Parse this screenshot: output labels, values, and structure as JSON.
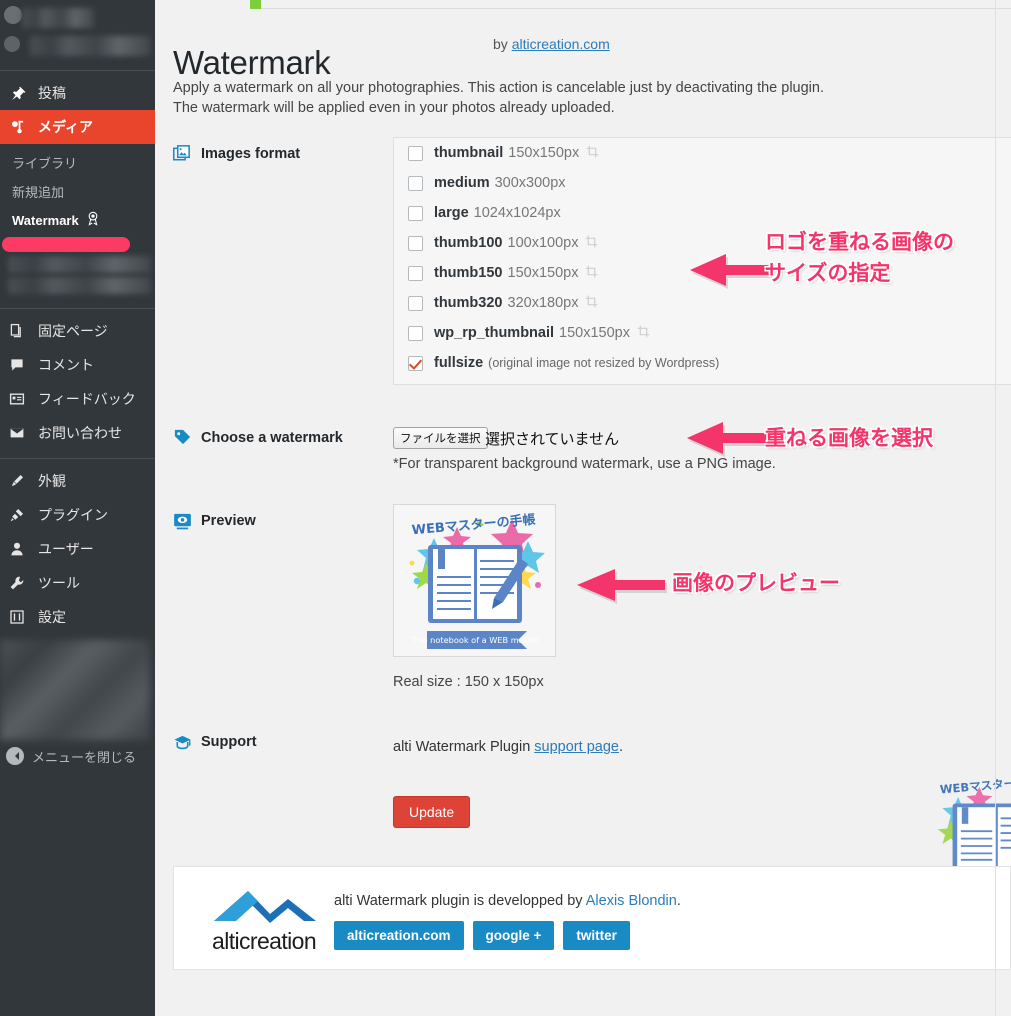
{
  "sidebar": {
    "items": [
      {
        "label": "投稿",
        "icon": "pin-icon",
        "state": "normal"
      },
      {
        "label": "メディア",
        "icon": "media-icon",
        "state": "current"
      }
    ],
    "media_submenu": [
      {
        "label": "ライブラリ",
        "active": false
      },
      {
        "label": "新規追加",
        "active": false
      },
      {
        "label": "Watermark",
        "active": true,
        "badge": "award-icon"
      }
    ],
    "items2": [
      {
        "label": "固定ページ",
        "icon": "pages-icon"
      },
      {
        "label": "コメント",
        "icon": "comment-icon"
      },
      {
        "label": "フィードバック",
        "icon": "feedback-icon"
      },
      {
        "label": "お問い合わせ",
        "icon": "mail-icon"
      }
    ],
    "items3": [
      {
        "label": "外観",
        "icon": "appearance-icon"
      },
      {
        "label": "プラグイン",
        "icon": "plugin-icon"
      },
      {
        "label": "ユーザー",
        "icon": "user-icon"
      },
      {
        "label": "ツール",
        "icon": "tools-icon"
      },
      {
        "label": "設定",
        "icon": "settings-icon"
      }
    ],
    "collapse_label": "メニューを閉じる"
  },
  "header": {
    "title": "Watermark",
    "by_label": "by",
    "by_link": "alticreation.com",
    "intro_line1": "Apply a watermark on all your photographies. This action is cancelable just by deactivating the plugin.",
    "intro_line2": "The watermark will be applied even in your photos already uploaded."
  },
  "rows": {
    "images_format_label": "Images format",
    "choose_watermark_label": "Choose a watermark",
    "preview_label": "Preview",
    "support_label": "Support"
  },
  "formats": [
    {
      "name": "thumbnail",
      "dim": "150x150px",
      "crop": true,
      "checked": false,
      "note": ""
    },
    {
      "name": "medium",
      "dim": "300x300px",
      "crop": false,
      "checked": false,
      "note": ""
    },
    {
      "name": "large",
      "dim": "1024x1024px",
      "crop": false,
      "checked": false,
      "note": ""
    },
    {
      "name": "thumb100",
      "dim": "100x100px",
      "crop": true,
      "checked": false,
      "note": ""
    },
    {
      "name": "thumb150",
      "dim": "150x150px",
      "crop": true,
      "checked": false,
      "note": ""
    },
    {
      "name": "thumb320",
      "dim": "320x180px",
      "crop": true,
      "checked": false,
      "note": ""
    },
    {
      "name": "wp_rp_thumbnail",
      "dim": "150x150px",
      "crop": true,
      "checked": false,
      "note": ""
    },
    {
      "name": "fullsize",
      "dim": "",
      "crop": false,
      "checked": true,
      "note": "(original image not resized by Wordpress)"
    }
  ],
  "file_input": {
    "button_label": "ファイルを選択",
    "no_file_label": "選択されていません",
    "png_note": "*For transparent background watermark, use a PNG image."
  },
  "preview": {
    "real_size": "Real size : 150 x 150px",
    "logo_title": "WEBマスターの手帳",
    "logo_banner": "The notebook of a  WEB master"
  },
  "support": {
    "text_before": "alti Watermark Plugin ",
    "link": "support page",
    "text_after": ".",
    "update_button": "Update"
  },
  "footer": {
    "credit_before": "alti Watermark plugin is developped by ",
    "credit_link": "Alexis Blondin",
    "credit_after": ".",
    "logo_word": "alticreation",
    "buttons": [
      {
        "label": "alticreation.com"
      },
      {
        "label": "google +"
      },
      {
        "label": "twitter"
      }
    ]
  },
  "annotations": [
    {
      "id": "anno-sizes",
      "line1": "ロゴを重ねる画像の",
      "line2": "サイズの指定"
    },
    {
      "id": "anno-choose",
      "line1": "重ねる画像を選択",
      "line2": ""
    },
    {
      "id": "anno-preview",
      "line1": "画像のプレビュー",
      "line2": ""
    }
  ],
  "colors": {
    "accent_pink": "#f3356b",
    "sidebar_bg": "#32373c",
    "current_red": "#e8452c",
    "link_blue": "#2b7bb9",
    "button_blue": "#1a8ac4",
    "update_red": "#dd4437"
  }
}
